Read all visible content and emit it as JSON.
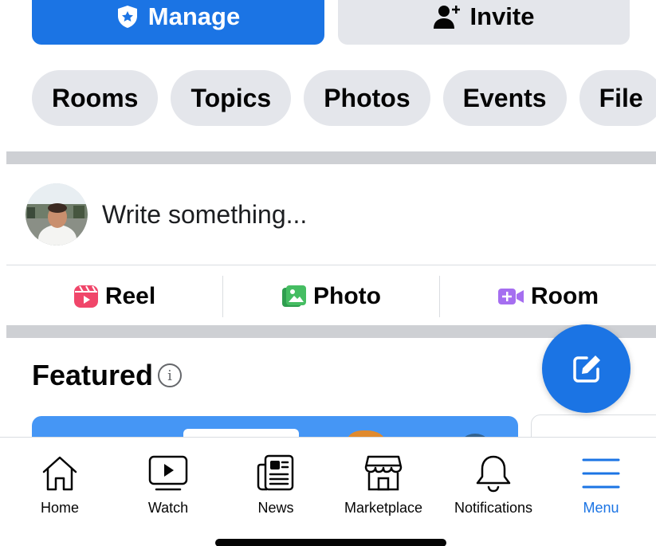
{
  "header_buttons": {
    "manage_label": "Manage",
    "invite_label": "Invite"
  },
  "chips": [
    {
      "label": "Rooms"
    },
    {
      "label": "Topics"
    },
    {
      "label": "Photos"
    },
    {
      "label": "Events"
    },
    {
      "label": "File"
    }
  ],
  "composer": {
    "placeholder": "Write something..."
  },
  "actions": {
    "reel": "Reel",
    "photo": "Photo",
    "room": "Room"
  },
  "featured": {
    "title": "Featured",
    "info_glyph": "i"
  },
  "tabbar": [
    {
      "label": "Home",
      "icon": "home-icon"
    },
    {
      "label": "Watch",
      "icon": "watch-icon"
    },
    {
      "label": "News",
      "icon": "news-icon"
    },
    {
      "label": "Marketplace",
      "icon": "marketplace-icon"
    },
    {
      "label": "Notifications",
      "icon": "bell-icon"
    },
    {
      "label": "Menu",
      "icon": "menu-icon"
    }
  ],
  "colors": {
    "accent": "#1b74e4",
    "chip_bg": "#e4e6eb",
    "divider": "#ced0d4",
    "reel_icon": "#f0466a",
    "photo_icon": "#45bd62",
    "room_icon": "#a56ef0"
  }
}
